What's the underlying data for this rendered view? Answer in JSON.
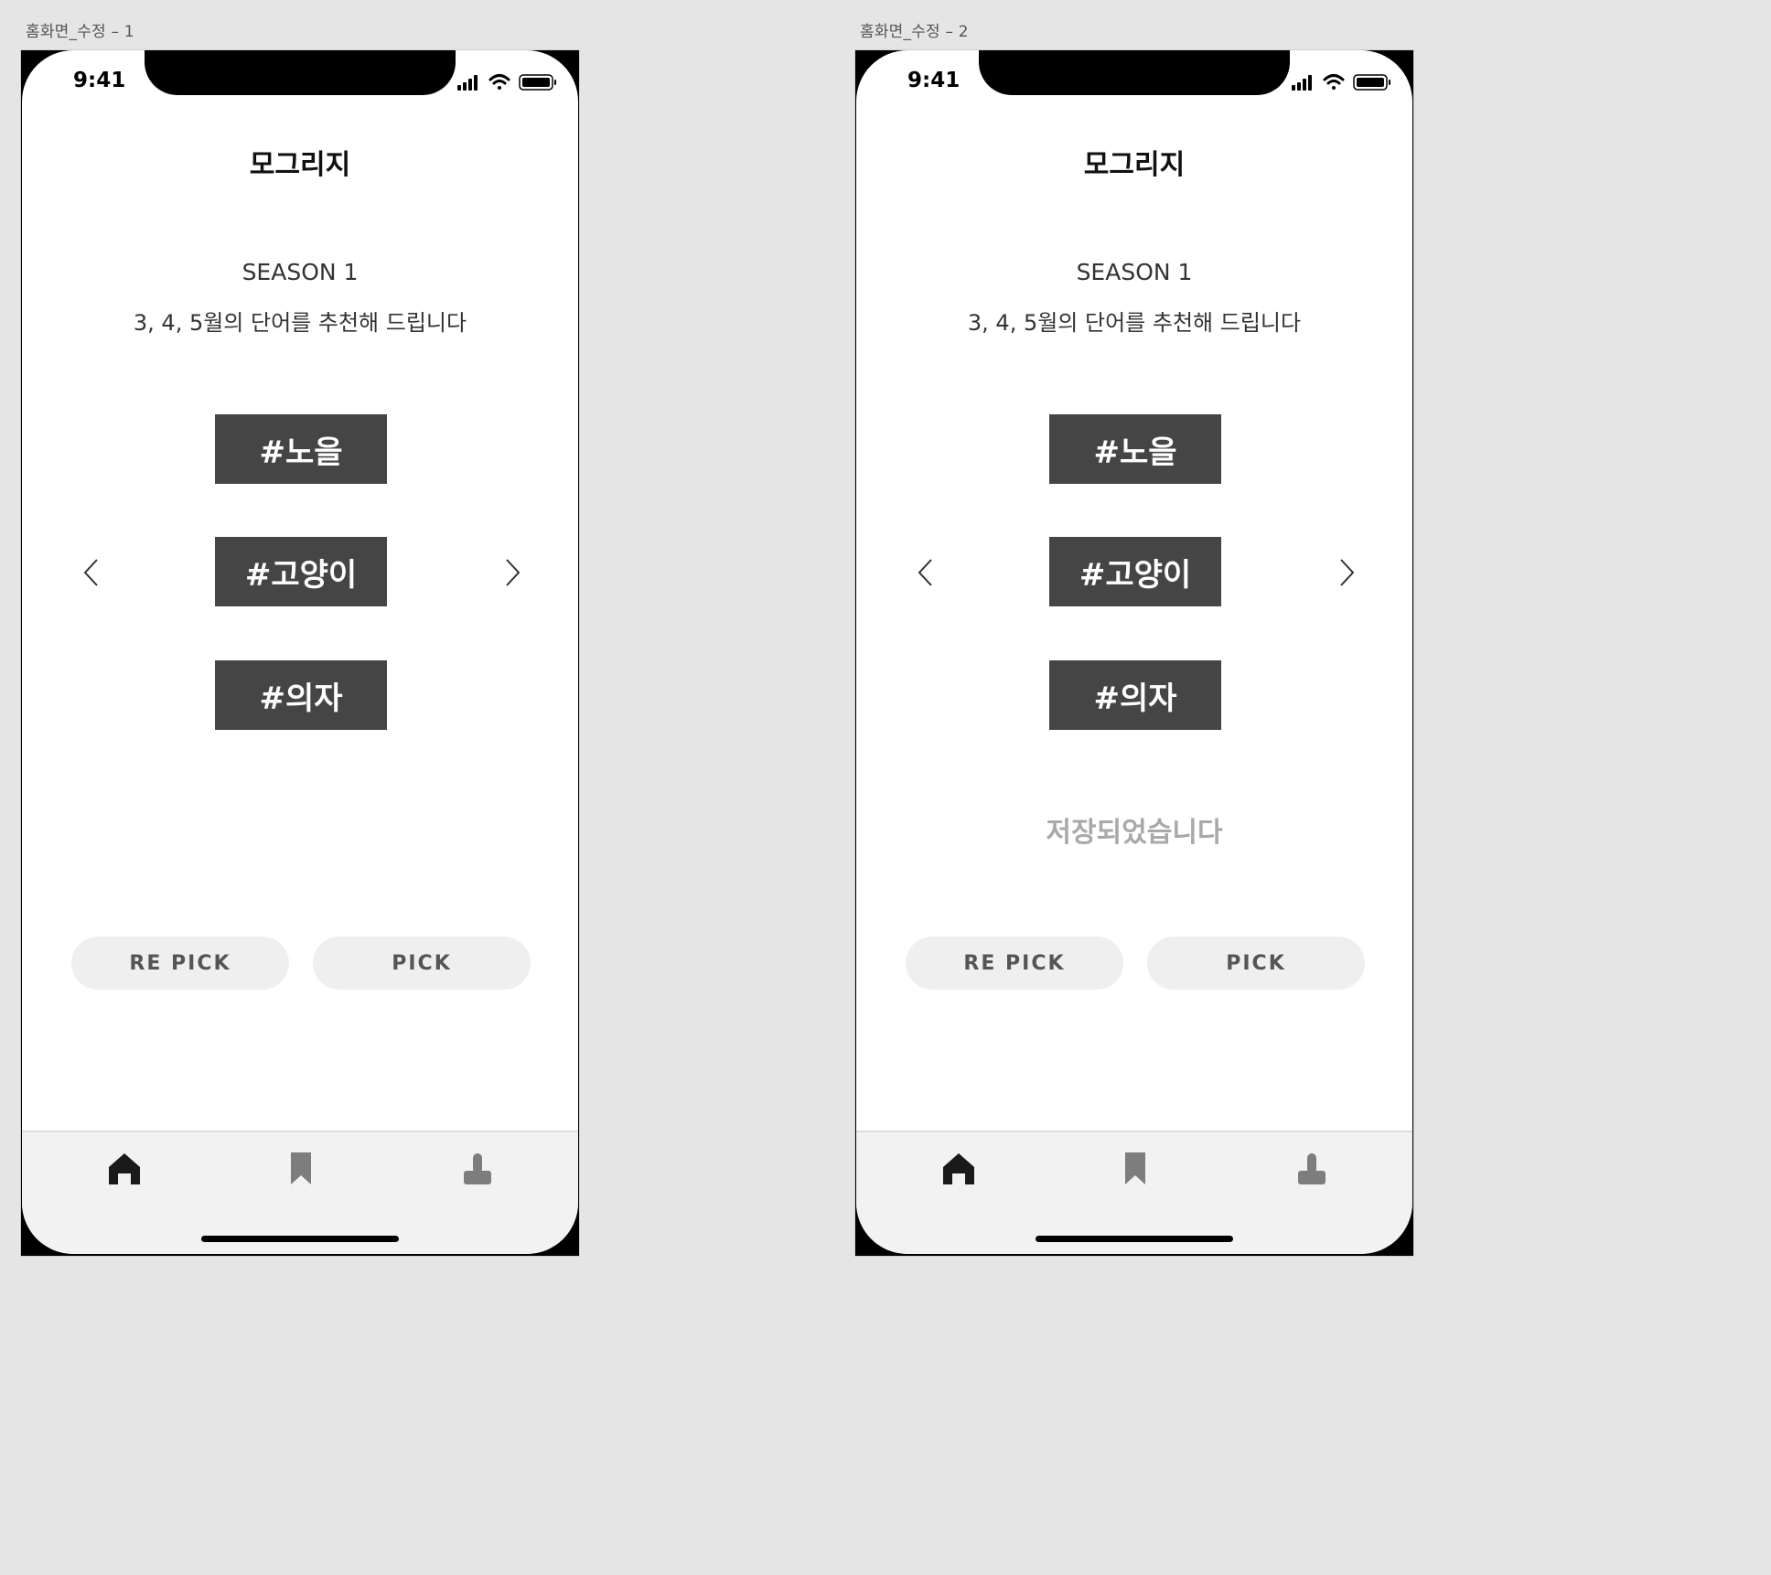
{
  "frames": [
    {
      "label": "홈화면_수정 – 1",
      "status_time": "9:41",
      "title": "모그리지",
      "season": "SEASON 1",
      "description": "3, 4, 5월의 단어를 추천해 드립니다",
      "tags": [
        "#노을",
        "#고양이",
        "#의자"
      ],
      "saved_message": "",
      "buttons": {
        "repick": "RE PICK",
        "pick": "PICK"
      },
      "tabs": [
        "home-icon",
        "bookmark-icon",
        "profile-icon"
      ]
    },
    {
      "label": "홈화면_수정 – 2",
      "status_time": "9:41",
      "title": "모그리지",
      "season": "SEASON 1",
      "description": "3, 4, 5월의 단어를 추천해 드립니다",
      "tags": [
        "#노을",
        "#고양이",
        "#의자"
      ],
      "saved_message": "저장되었습니다",
      "buttons": {
        "repick": "RE PICK",
        "pick": "PICK"
      },
      "tabs": [
        "home-icon",
        "bookmark-icon",
        "profile-icon"
      ]
    }
  ],
  "colors": {
    "background": "#e5e5e5",
    "tag_bg": "#454545",
    "pill_bg": "#efefef",
    "tabbar_bg": "#f2f2f2",
    "saved_text": "#a9a9a9",
    "active_tab": "#1a1a1a",
    "inactive_tab": "#7d7d7d"
  }
}
